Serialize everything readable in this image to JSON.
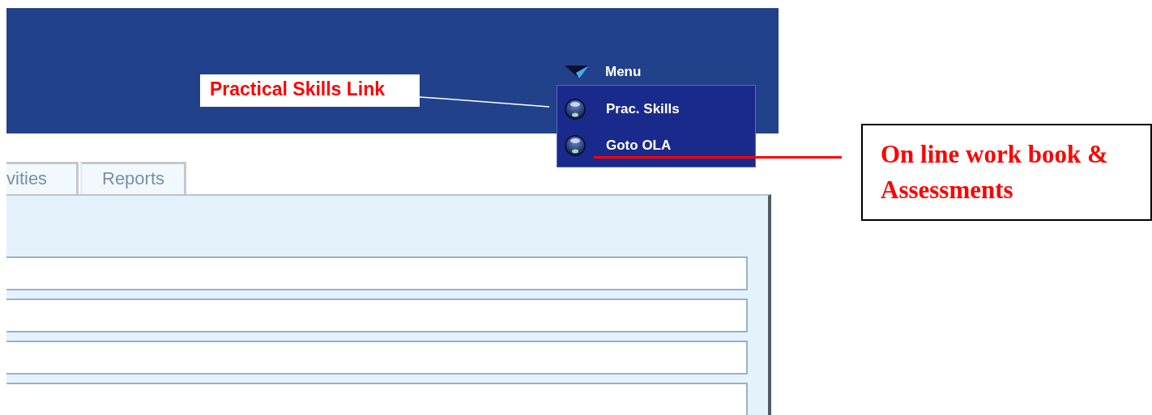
{
  "header": {
    "menu": {
      "label": "Menu",
      "items": [
        {
          "label": "Prac. Skills"
        },
        {
          "label": "Goto OLA"
        }
      ]
    }
  },
  "tabs": [
    {
      "label": "vities",
      "selected": false
    },
    {
      "label": "Reports",
      "selected": false
    }
  ],
  "fields": [
    {
      "kind": "text"
    },
    {
      "kind": "text"
    },
    {
      "kind": "text"
    },
    {
      "kind": "text"
    }
  ],
  "annotations": [
    {
      "kind": "label",
      "text": "Practical Skills Link"
    },
    {
      "kind": "callout",
      "text": "On line work book & Assessments"
    }
  ]
}
